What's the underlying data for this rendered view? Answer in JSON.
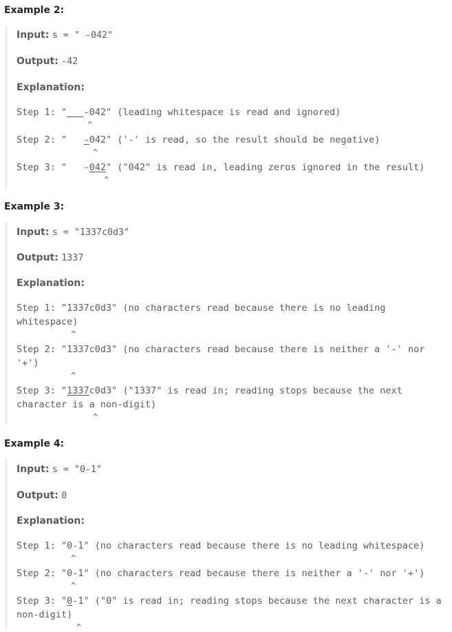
{
  "examples": [
    {
      "heading": "Example 2:",
      "input_label": "Input:",
      "input_value": "s = \" -042\"",
      "output_label": "Output:",
      "output_value": "-42",
      "explanation_label": "Explanation:",
      "steps": [
        {
          "prefix": "Step 1: \"",
          "underlined": "___",
          "rest": "-042\" (leading whitespace is read and ignored)",
          "caret": "^"
        },
        {
          "prefix": "Step 2: \"   ",
          "underlined": "-",
          "rest": "042\" ('-' is read, so the result should be negative)",
          "caret": "^"
        },
        {
          "prefix": "Step 3: \"   -",
          "underlined": "042",
          "rest": "\" (\"042\" is read in, leading zeros ignored in the result)",
          "caret": "^"
        }
      ]
    },
    {
      "heading": "Example 3:",
      "input_label": "Input:",
      "input_value": "s = \"1337c0d3\"",
      "output_label": "Output:",
      "output_value": "1337",
      "explanation_label": "Explanation:",
      "steps": [
        {
          "prefix": "Step 1: \"1337c0d3\" (no characters read because there is no leading whitespace)",
          "underlined": "",
          "rest": "",
          "caret": "^"
        },
        {
          "prefix": "Step 2: \"1337c0d3\" (no characters read because there is neither a '-' nor '+')",
          "underlined": "",
          "rest": "",
          "caret": "^"
        },
        {
          "prefix": "Step 3: \"",
          "underlined": "1337",
          "rest": "c0d3\" (\"1337\" is read in; reading stops because the next character is a non-digit)",
          "caret": "^"
        }
      ]
    },
    {
      "heading": "Example 4:",
      "input_label": "Input:",
      "input_value": "s = \"0-1\"",
      "output_label": "Output:",
      "output_value": "0",
      "explanation_label": "Explanation:",
      "steps": [
        {
          "prefix": "Step 1: \"0-1\" (no characters read because there is no leading whitespace)",
          "underlined": "",
          "rest": "",
          "caret": "^"
        },
        {
          "prefix": "Step 2: \"0-1\" (no characters read because there is neither a '-' nor '+')",
          "underlined": "",
          "rest": "",
          "caret": "^"
        },
        {
          "prefix": "Step 3: \"",
          "underlined": "0",
          "rest": "-1\" (\"0\" is read in; reading stops because the next character is a non-digit)",
          "caret": "^"
        }
      ]
    }
  ]
}
